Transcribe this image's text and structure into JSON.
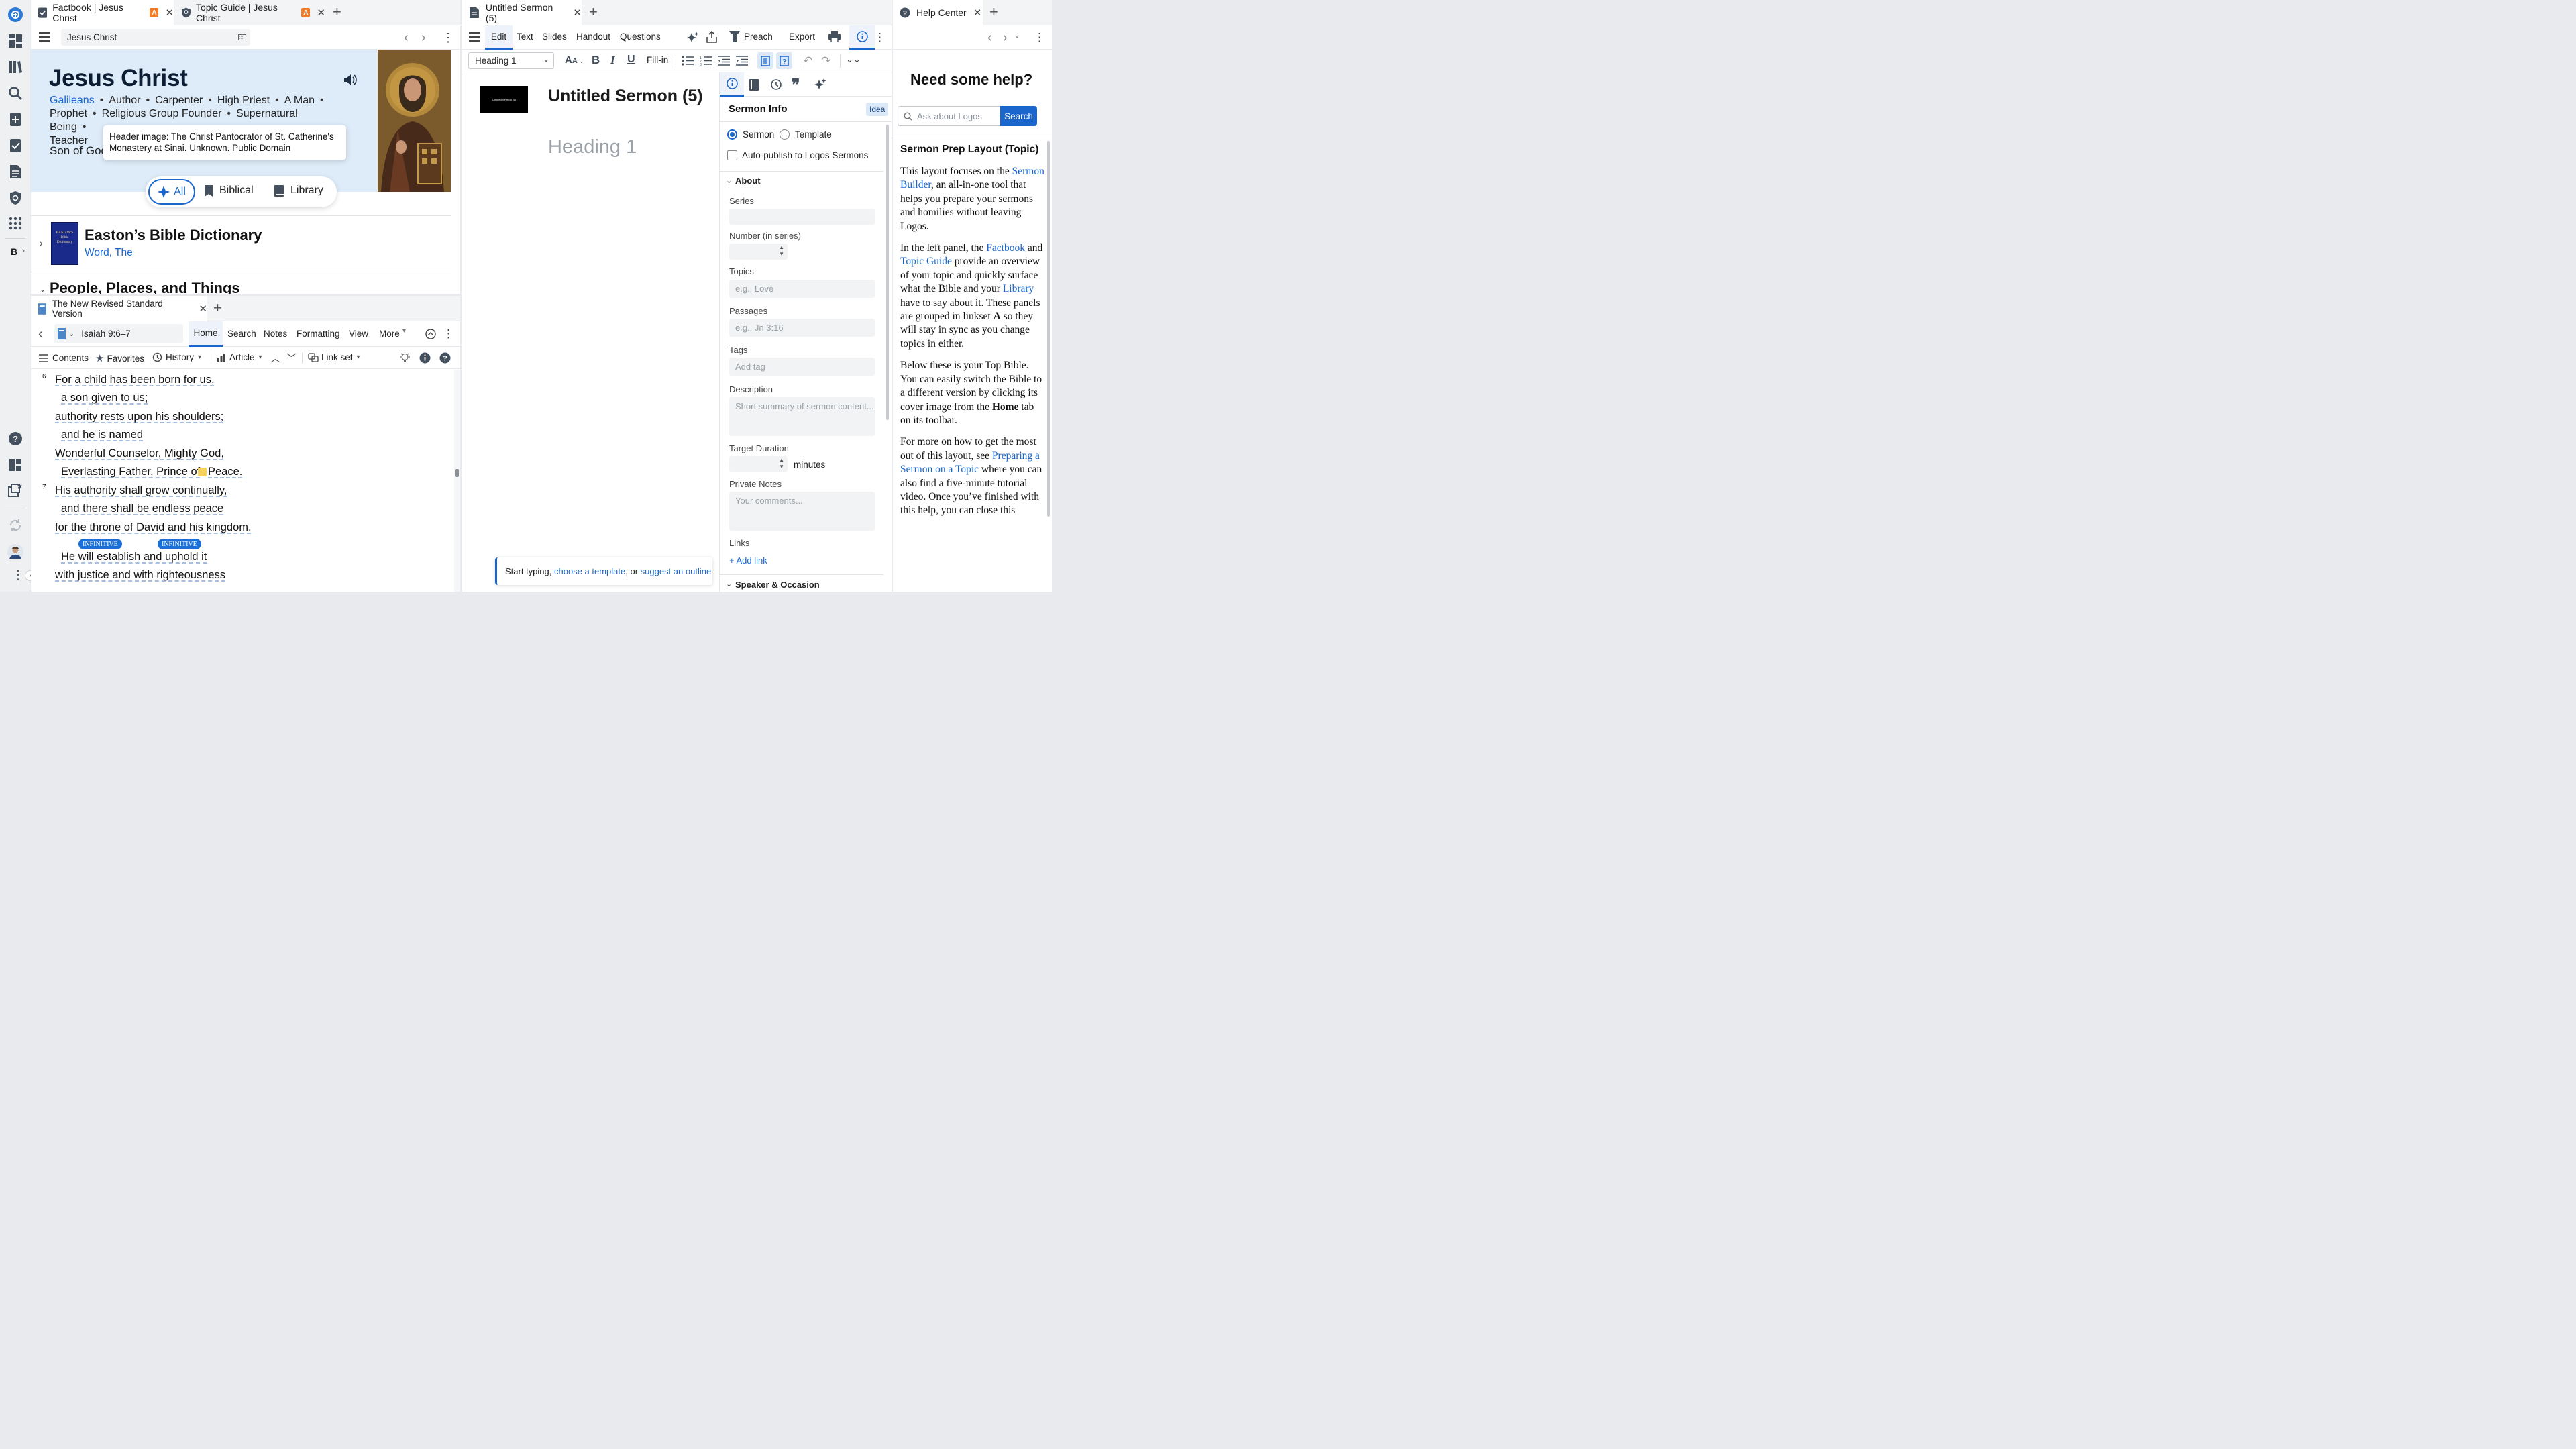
{
  "rail": {
    "icons": [
      "logos-home-icon",
      "dashboard-icon",
      "library-icon",
      "search-icon",
      "guides-icon",
      "checklist-icon",
      "document-icon",
      "shield-icon",
      "apps-icon"
    ],
    "bottom_label": "B",
    "bottom_icons": [
      "help-icon",
      "layouts-icon",
      "close-windows-icon",
      "sync-icon",
      "user-avatar",
      "more-icon"
    ]
  },
  "factbook": {
    "tabs": [
      {
        "label": "Factbook | Jesus Christ",
        "badge": "A"
      },
      {
        "label": "Topic Guide | Jesus Christ",
        "badge": "A"
      }
    ],
    "search_value": "Jesus Christ",
    "title": "Jesus Christ",
    "tags": [
      "Galileans",
      "Author",
      "Carpenter",
      "High Priest",
      "A Man",
      "Prophet",
      "Religious Group Founder",
      "Supernatural Being",
      "Teacher"
    ],
    "son_of": "Son of God",
    "tooltip": "Header image: The Christ Pantocrator of St. Catherine's Monastery at Sinai. Unknown. Public Domain",
    "filters": [
      "All",
      "Biblical",
      "Library"
    ],
    "dictionary": {
      "title": "Easton’s Bible Dictionary",
      "subtitle": "Word, The",
      "cover_text": "EASTON'S Bible Dictionary"
    },
    "section": "People, Places, and Things"
  },
  "bible": {
    "tab": "The New Revised Standard Version",
    "reference": "Isaiah 9:6–7",
    "menu": [
      "Home",
      "Search",
      "Notes",
      "Formatting",
      "View",
      "More"
    ],
    "toolbar": {
      "contents": "Contents",
      "favorites": "Favorites",
      "history": "History",
      "article": "Article",
      "linkset": "Link set"
    },
    "verse6_num": "6",
    "verse7_num": "7",
    "lines6": [
      "For a child has been born for us,",
      "a son given to us;",
      "authority rests upon his shoulders;",
      "and he is named",
      "Wonderful Counselor, Mighty God,",
      "Everlasting Father, Prince of",
      "Peace."
    ],
    "lines7": [
      "His authority shall grow continually,",
      "and there shall be endless peace",
      "for the throne of David and his kingdom.",
      "He will establish and uphold it",
      "with justice and with righteousness"
    ],
    "badges": [
      "INFINITIVE",
      "INFINITIVE"
    ]
  },
  "sermon": {
    "tab": "Untitled Sermon (5)",
    "menu": [
      "Edit",
      "Text",
      "Slides",
      "Handout",
      "Questions"
    ],
    "preach": "Preach",
    "export": "Export",
    "style_select": "Heading 1",
    "fillin": "Fill-in",
    "thumb_text": "Untitled Sermon (5)",
    "doc_title": "Untitled Sermon (5)",
    "heading_placeholder": "Heading 1",
    "hint": {
      "prefix": "Start typing, ",
      "link1": "choose a template",
      "mid": ", or ",
      "link2": "suggest an outline"
    }
  },
  "sermon_info": {
    "title": "Sermon Info",
    "idea": "Idea",
    "radio_sermon": "Sermon",
    "radio_template": "Template",
    "autopublish": "Auto-publish to Logos Sermons",
    "about": "About",
    "series": "Series",
    "number": "Number (in series)",
    "topics": "Topics",
    "topics_ph": "e.g., Love",
    "passages": "Passages",
    "passages_ph": "e.g., Jn 3:16",
    "tags": "Tags",
    "tags_ph": "Add tag",
    "description": "Description",
    "description_ph": "Short summary of sermon content...",
    "target": "Target Duration",
    "minutes": "minutes",
    "notes": "Private Notes",
    "notes_ph": "Your comments...",
    "links": "Links",
    "add_link": "+ Add link",
    "speaker": "Speaker & Occasion"
  },
  "help": {
    "tab": "Help Center",
    "heading": "Need some help?",
    "search_ph": "Ask about Logos",
    "search_btn": "Search",
    "title": "Sermon Prep Layout (Topic)",
    "p1a": "This layout focuses on the ",
    "p1link": "Sermon Builder",
    "p1b": ", an all-in-one tool that helps you prepare your sermons and homilies without leaving Logos.",
    "p2a": "In the left panel, the ",
    "p2l1": "Factbook",
    "p2b": " and ",
    "p2l2": "Topic Guide",
    "p2c": " provide an overview of your topic and quickly surface what the Bible and your ",
    "p2l3": "Library",
    "p2d": " have to say about it. These panels are grouped in linkset ",
    "p2bold": "A",
    "p2e": " so they will stay in sync as you change topics in either.",
    "p3a": "Below these is your Top Bible. You can easily switch the Bible to a different version by clicking its cover image from the ",
    "p3bold": "Home",
    "p3b": " tab on its toolbar.",
    "p4a": "For more on how to get the most out of this layout, see ",
    "p4link": "Preparing a Sermon on a Topic",
    "p4b": " where you can also find a five-minute tutorial video. Once you’ve finished with this help, you can close this"
  }
}
